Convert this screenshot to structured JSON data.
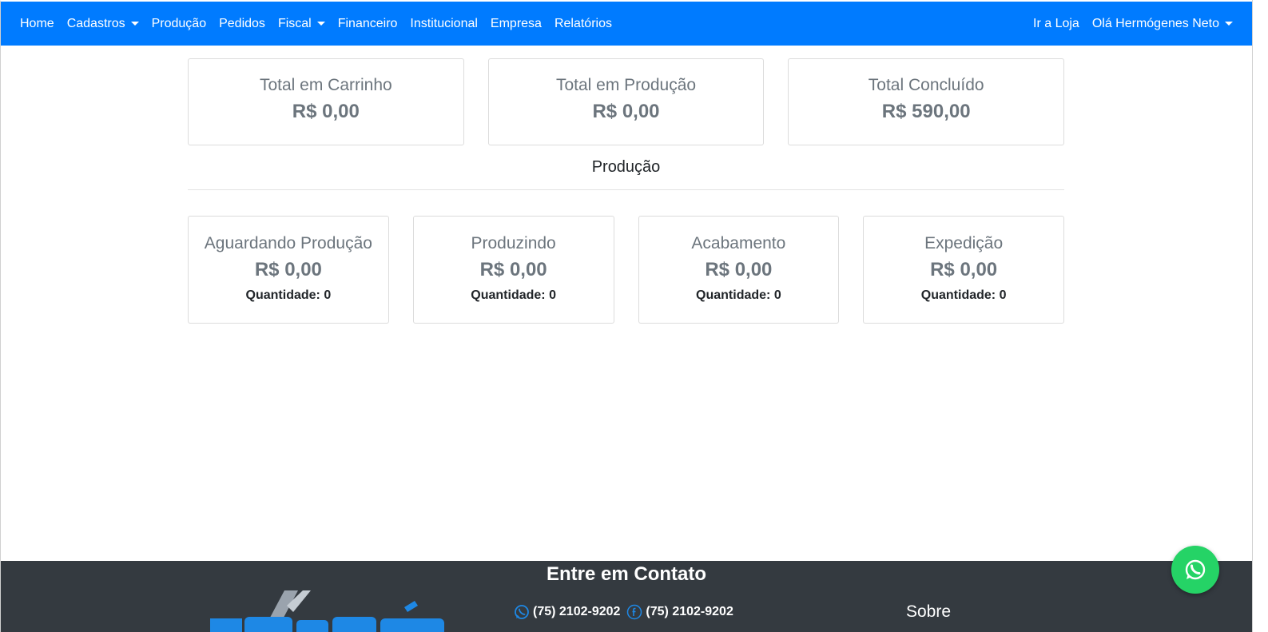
{
  "navbar": {
    "left_items": [
      {
        "label": "Home",
        "dropdown": false
      },
      {
        "label": "Cadastros",
        "dropdown": true
      },
      {
        "label": "Produção",
        "dropdown": false
      },
      {
        "label": "Pedidos",
        "dropdown": false
      },
      {
        "label": "Fiscal",
        "dropdown": true
      },
      {
        "label": "Financeiro",
        "dropdown": false
      },
      {
        "label": "Institucional",
        "dropdown": false
      },
      {
        "label": "Empresa",
        "dropdown": false
      },
      {
        "label": "Relatórios",
        "dropdown": false
      }
    ],
    "store_link": "Ir a Loja",
    "user_menu": "Olá Hermógenes Neto",
    "color": "#007bff"
  },
  "summary": [
    {
      "title": "Total em Carrinho",
      "value": "R$ 0,00"
    },
    {
      "title": "Total em Produção",
      "value": "R$ 0,00"
    },
    {
      "title": "Total Concluído",
      "value": "R$ 590,00"
    }
  ],
  "production": {
    "title": "Produção",
    "stages": [
      {
        "title": "Aguardando Produção",
        "value": "R$ 0,00",
        "quantity": "Quantidade: 0"
      },
      {
        "title": "Produzindo",
        "value": "R$ 0,00",
        "quantity": "Quantidade: 0"
      },
      {
        "title": "Acabamento",
        "value": "R$ 0,00",
        "quantity": "Quantidade: 0"
      },
      {
        "title": "Expedição",
        "value": "R$ 0,00",
        "quantity": "Quantidade: 0"
      }
    ]
  },
  "footer": {
    "title": "Entre em Contato",
    "whatsapp_phone": "(75) 2102-9202",
    "facebook_phone": "(75) 2102-9202",
    "about": "Sobre",
    "background": "#343a40",
    "icons": [
      "whatsapp-icon",
      "facebook-icon"
    ]
  },
  "whatsapp_button": {
    "icon": "whatsapp-icon",
    "color": "#25d366"
  }
}
